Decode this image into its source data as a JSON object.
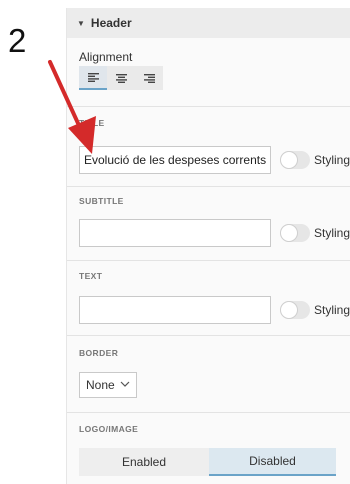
{
  "step_number": "2",
  "header": {
    "title": "Header",
    "caret_icon": "caret-down-icon"
  },
  "alignment": {
    "label": "Alignment",
    "options": [
      "align-left",
      "align-center",
      "align-right"
    ],
    "selected": "align-left"
  },
  "title_section": {
    "label": "TITLE",
    "value": "Evolució de les despeses corrents per",
    "styling_label": "Styling"
  },
  "subtitle_section": {
    "label": "SUBTITLE",
    "value": "",
    "styling_label": "Styling"
  },
  "text_section": {
    "label": "TEXT",
    "value": "",
    "styling_label": "Styling"
  },
  "border_section": {
    "label": "BORDER",
    "selected": "None"
  },
  "logo_section": {
    "label": "LOGO/IMAGE",
    "enabled_label": "Enabled",
    "disabled_label": "Disabled",
    "selected": "Disabled"
  },
  "colors": {
    "accent": "#6aa3c8",
    "arrow": "#d42a2a"
  }
}
